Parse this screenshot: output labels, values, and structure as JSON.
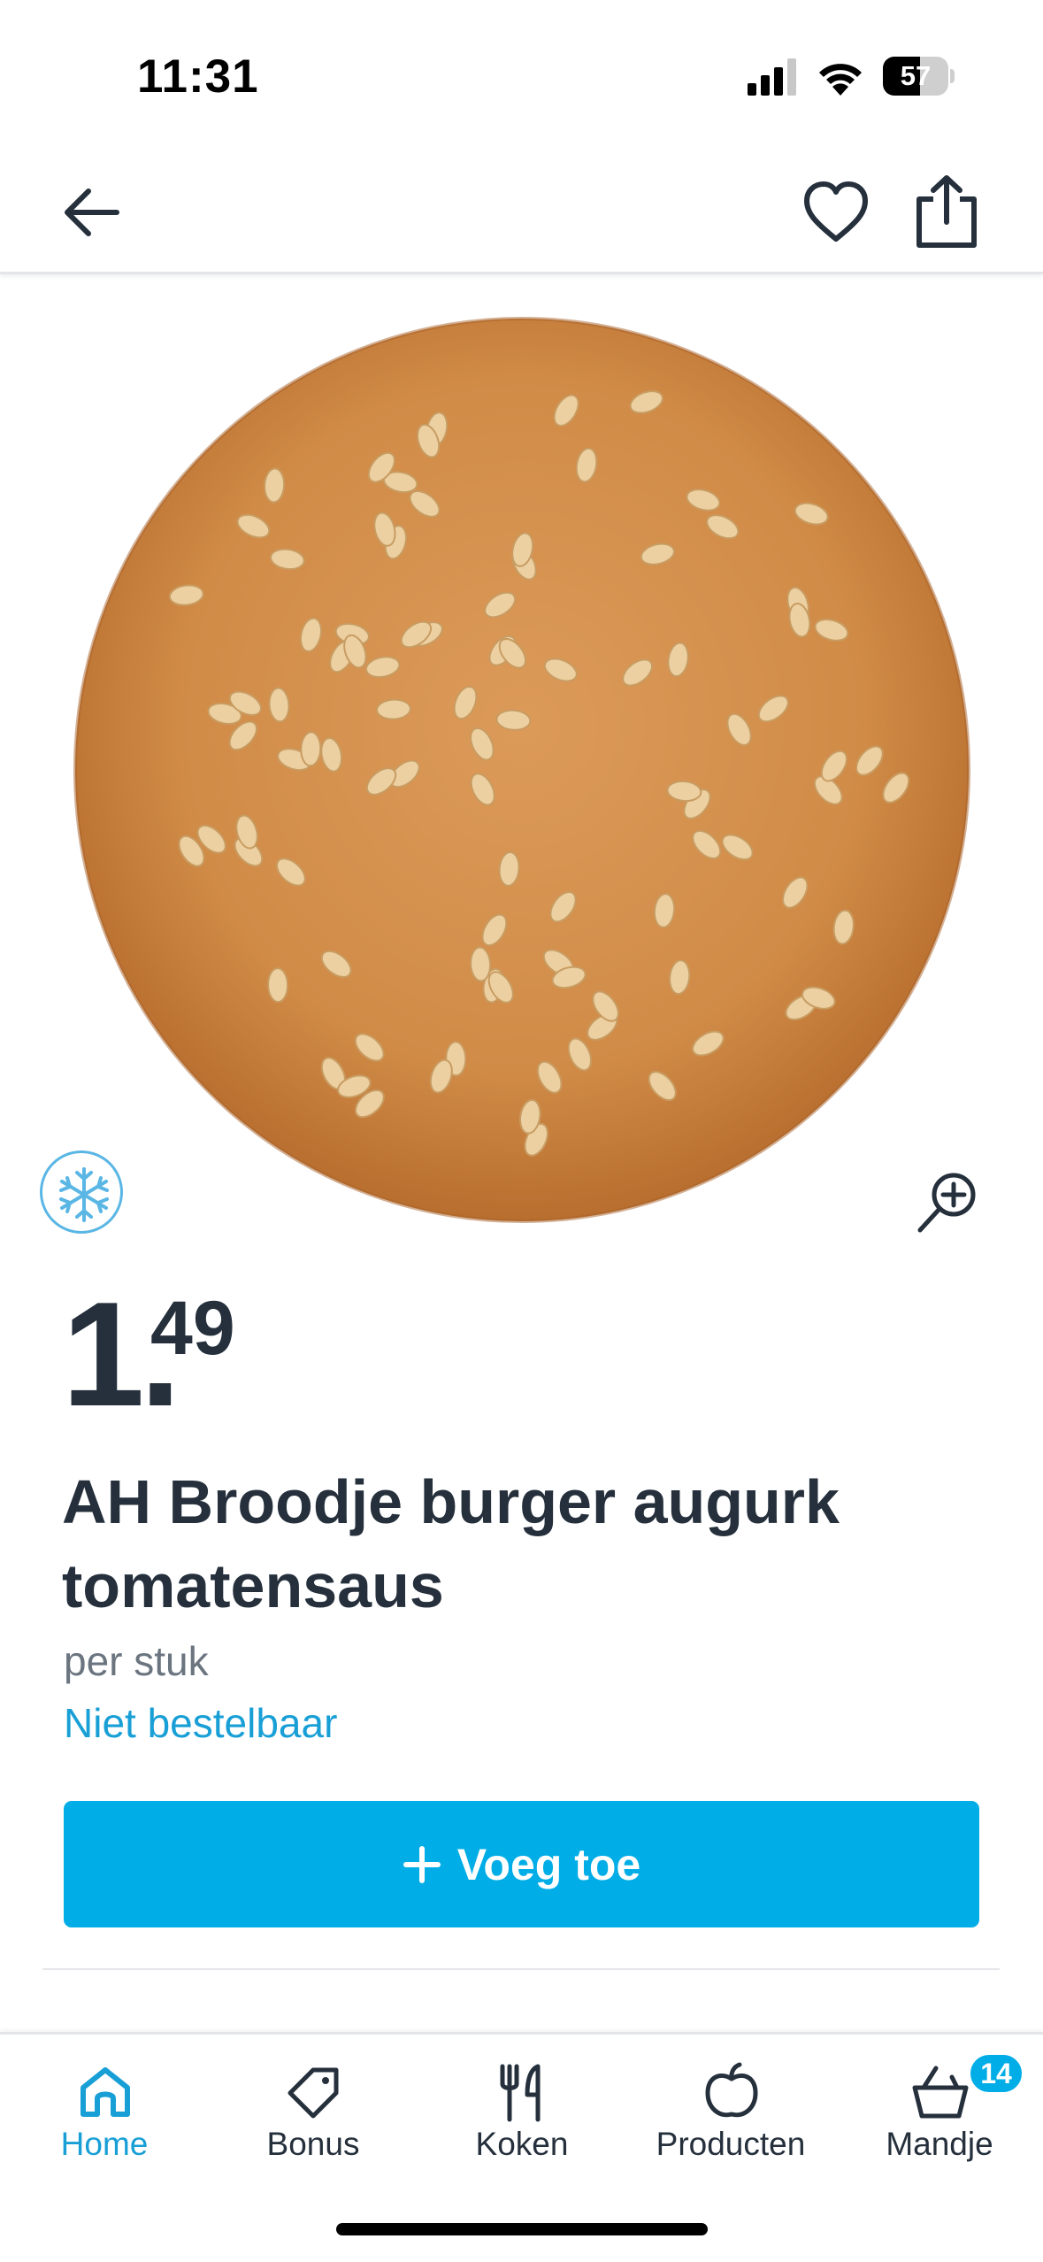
{
  "status_bar": {
    "time": "11:31",
    "battery_level": "57",
    "battery_fraction": 0.57,
    "icons": [
      "signal-icon",
      "wifi-icon",
      "battery-icon"
    ]
  },
  "top_nav": {
    "icons": [
      "arrow-left-icon",
      "heart-icon",
      "share-icon"
    ]
  },
  "product": {
    "image_name": "sesame-burger-bun",
    "badge_icon": "snowflake-icon",
    "zoom_icon": "zoom-in-icon",
    "price_whole": "1",
    "price_dot": ".",
    "price_cents": "49",
    "title": "AH Broodje burger augurk tomatensaus",
    "unit": "per stuk",
    "availability": "Niet bestelbaar",
    "add_button_label": "Voeg toe",
    "add_button_icon": "plus-icon"
  },
  "colors": {
    "accent": "#00ade6",
    "link": "#189fd6",
    "text": "#25303c",
    "muted": "#6b7580"
  },
  "tab_bar": {
    "tabs": [
      {
        "label": "Home",
        "icon": "home-icon",
        "active": true
      },
      {
        "label": "Bonus",
        "icon": "tag-icon",
        "active": false
      },
      {
        "label": "Koken",
        "icon": "cutlery-icon",
        "active": false
      },
      {
        "label": "Producten",
        "icon": "apple-icon",
        "active": false
      },
      {
        "label": "Mandje",
        "icon": "basket-icon",
        "active": false
      }
    ],
    "cart_count": "14"
  }
}
